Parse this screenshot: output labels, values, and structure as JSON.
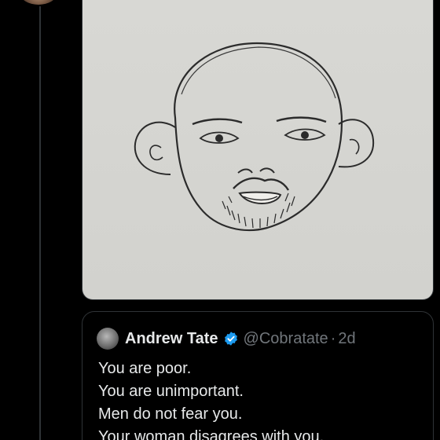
{
  "post": {
    "media_alt": ""
  },
  "quoted_tweet": {
    "author_name": "Andrew Tate",
    "author_handle": "@Cobratate",
    "separator": "·",
    "timestamp": "2d",
    "verified": true,
    "lines": [
      "You are poor.",
      "You are unimportant.",
      "Men do not fear you.",
      "Your woman disagrees with you."
    ]
  },
  "colors": {
    "background": "#000000",
    "primary_text": "#e7e9ea",
    "secondary_text": "#71767b",
    "verified_blue": "#1d9bf0",
    "border": "#2f3336"
  },
  "icons": {
    "verified": "verified-badge-icon"
  }
}
